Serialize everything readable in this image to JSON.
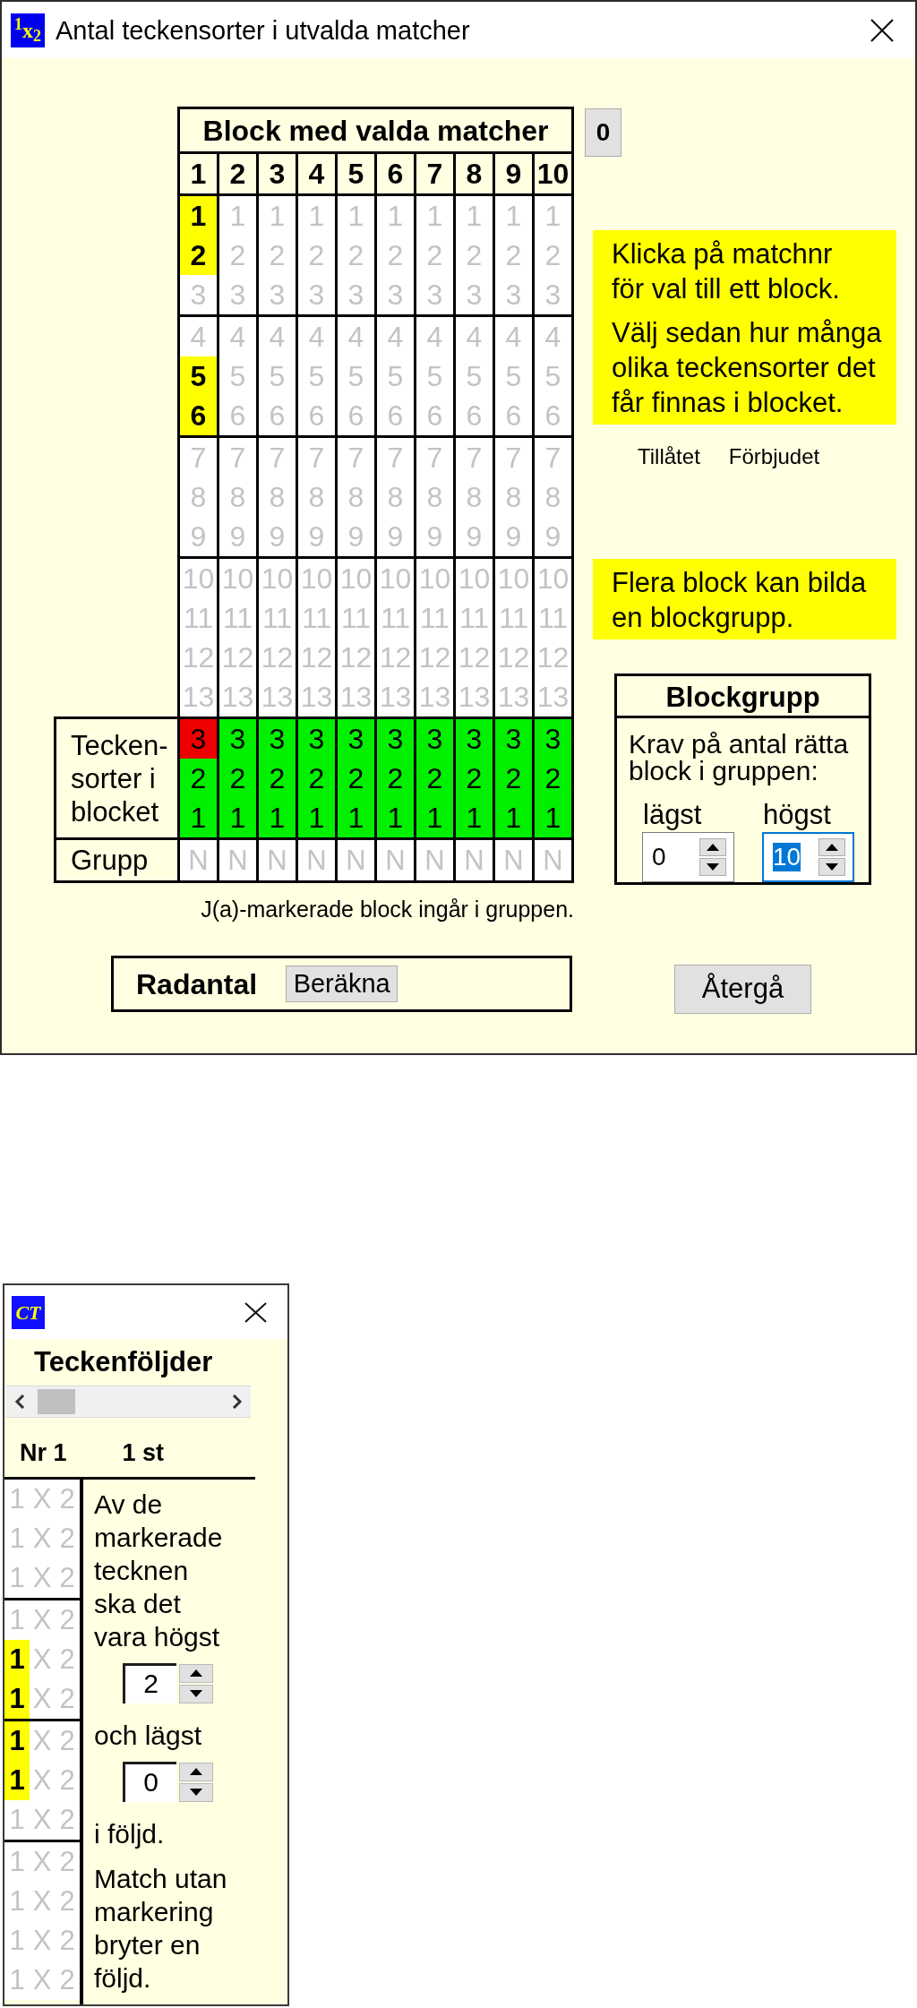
{
  "window": {
    "app_icon": "$^{1}$x$_{2}$",
    "title": "Antal teckensorter i utvalda matcher"
  },
  "grid": {
    "title": "Block med valda matcher",
    "row_labels": [
      "Tecken-\nsorter i\nblocket",
      "Grupp"
    ],
    "columns": [
      {
        "label": "1",
        "match_groups": [
          [
            {
              "text": "1",
              "marked": true
            },
            {
              "text": "2",
              "marked": true
            },
            {
              "text": "3",
              "marked": false
            }
          ],
          [
            {
              "text": "4",
              "marked": false
            },
            {
              "text": "5",
              "marked": true
            },
            {
              "text": "6",
              "marked": true
            }
          ],
          [
            {
              "text": "7",
              "marked": false
            },
            {
              "text": "8",
              "marked": false
            },
            {
              "text": "9",
              "marked": false
            }
          ],
          [
            {
              "text": "10",
              "marked": false
            },
            {
              "text": "11",
              "marked": false
            },
            {
              "text": "12",
              "marked": false
            },
            {
              "text": "13",
              "marked": false
            }
          ]
        ],
        "sign_sorts": [
          {
            "text": "3",
            "allowed": false
          },
          {
            "text": "2",
            "allowed": true
          },
          {
            "text": "1",
            "allowed": true
          }
        ],
        "group": "N"
      },
      {
        "label": "2",
        "match_groups": [
          [
            {
              "text": "1",
              "marked": false
            },
            {
              "text": "2",
              "marked": false
            },
            {
              "text": "3",
              "marked": false
            }
          ],
          [
            {
              "text": "4",
              "marked": false
            },
            {
              "text": "5",
              "marked": false
            },
            {
              "text": "6",
              "marked": false
            }
          ],
          [
            {
              "text": "7",
              "marked": false
            },
            {
              "text": "8",
              "marked": false
            },
            {
              "text": "9",
              "marked": false
            }
          ],
          [
            {
              "text": "10",
              "marked": false
            },
            {
              "text": "11",
              "marked": false
            },
            {
              "text": "12",
              "marked": false
            },
            {
              "text": "13",
              "marked": false
            }
          ]
        ],
        "sign_sorts": [
          {
            "text": "3",
            "allowed": true
          },
          {
            "text": "2",
            "allowed": true
          },
          {
            "text": "1",
            "allowed": true
          }
        ],
        "group": "N"
      },
      {
        "label": "3",
        "match_groups": [
          [
            {
              "text": "1",
              "marked": false
            },
            {
              "text": "2",
              "marked": false
            },
            {
              "text": "3",
              "marked": false
            }
          ],
          [
            {
              "text": "4",
              "marked": false
            },
            {
              "text": "5",
              "marked": false
            },
            {
              "text": "6",
              "marked": false
            }
          ],
          [
            {
              "text": "7",
              "marked": false
            },
            {
              "text": "8",
              "marked": false
            },
            {
              "text": "9",
              "marked": false
            }
          ],
          [
            {
              "text": "10",
              "marked": false
            },
            {
              "text": "11",
              "marked": false
            },
            {
              "text": "12",
              "marked": false
            },
            {
              "text": "13",
              "marked": false
            }
          ]
        ],
        "sign_sorts": [
          {
            "text": "3",
            "allowed": true
          },
          {
            "text": "2",
            "allowed": true
          },
          {
            "text": "1",
            "allowed": true
          }
        ],
        "group": "N"
      },
      {
        "label": "4",
        "match_groups": [
          [
            {
              "text": "1",
              "marked": false
            },
            {
              "text": "2",
              "marked": false
            },
            {
              "text": "3",
              "marked": false
            }
          ],
          [
            {
              "text": "4",
              "marked": false
            },
            {
              "text": "5",
              "marked": false
            },
            {
              "text": "6",
              "marked": false
            }
          ],
          [
            {
              "text": "7",
              "marked": false
            },
            {
              "text": "8",
              "marked": false
            },
            {
              "text": "9",
              "marked": false
            }
          ],
          [
            {
              "text": "10",
              "marked": false
            },
            {
              "text": "11",
              "marked": false
            },
            {
              "text": "12",
              "marked": false
            },
            {
              "text": "13",
              "marked": false
            }
          ]
        ],
        "sign_sorts": [
          {
            "text": "3",
            "allowed": true
          },
          {
            "text": "2",
            "allowed": true
          },
          {
            "text": "1",
            "allowed": true
          }
        ],
        "group": "N"
      },
      {
        "label": "5",
        "match_groups": [
          [
            {
              "text": "1",
              "marked": false
            },
            {
              "text": "2",
              "marked": false
            },
            {
              "text": "3",
              "marked": false
            }
          ],
          [
            {
              "text": "4",
              "marked": false
            },
            {
              "text": "5",
              "marked": false
            },
            {
              "text": "6",
              "marked": false
            }
          ],
          [
            {
              "text": "7",
              "marked": false
            },
            {
              "text": "8",
              "marked": false
            },
            {
              "text": "9",
              "marked": false
            }
          ],
          [
            {
              "text": "10",
              "marked": false
            },
            {
              "text": "11",
              "marked": false
            },
            {
              "text": "12",
              "marked": false
            },
            {
              "text": "13",
              "marked": false
            }
          ]
        ],
        "sign_sorts": [
          {
            "text": "3",
            "allowed": true
          },
          {
            "text": "2",
            "allowed": true
          },
          {
            "text": "1",
            "allowed": true
          }
        ],
        "group": "N"
      },
      {
        "label": "6",
        "match_groups": [
          [
            {
              "text": "1",
              "marked": false
            },
            {
              "text": "2",
              "marked": false
            },
            {
              "text": "3",
              "marked": false
            }
          ],
          [
            {
              "text": "4",
              "marked": false
            },
            {
              "text": "5",
              "marked": false
            },
            {
              "text": "6",
              "marked": false
            }
          ],
          [
            {
              "text": "7",
              "marked": false
            },
            {
              "text": "8",
              "marked": false
            },
            {
              "text": "9",
              "marked": false
            }
          ],
          [
            {
              "text": "10",
              "marked": false
            },
            {
              "text": "11",
              "marked": false
            },
            {
              "text": "12",
              "marked": false
            },
            {
              "text": "13",
              "marked": false
            }
          ]
        ],
        "sign_sorts": [
          {
            "text": "3",
            "allowed": true
          },
          {
            "text": "2",
            "allowed": true
          },
          {
            "text": "1",
            "allowed": true
          }
        ],
        "group": "N"
      },
      {
        "label": "7",
        "match_groups": [
          [
            {
              "text": "1",
              "marked": false
            },
            {
              "text": "2",
              "marked": false
            },
            {
              "text": "3",
              "marked": false
            }
          ],
          [
            {
              "text": "4",
              "marked": false
            },
            {
              "text": "5",
              "marked": false
            },
            {
              "text": "6",
              "marked": false
            }
          ],
          [
            {
              "text": "7",
              "marked": false
            },
            {
              "text": "8",
              "marked": false
            },
            {
              "text": "9",
              "marked": false
            }
          ],
          [
            {
              "text": "10",
              "marked": false
            },
            {
              "text": "11",
              "marked": false
            },
            {
              "text": "12",
              "marked": false
            },
            {
              "text": "13",
              "marked": false
            }
          ]
        ],
        "sign_sorts": [
          {
            "text": "3",
            "allowed": true
          },
          {
            "text": "2",
            "allowed": true
          },
          {
            "text": "1",
            "allowed": true
          }
        ],
        "group": "N"
      },
      {
        "label": "8",
        "match_groups": [
          [
            {
              "text": "1",
              "marked": false
            },
            {
              "text": "2",
              "marked": false
            },
            {
              "text": "3",
              "marked": false
            }
          ],
          [
            {
              "text": "4",
              "marked": false
            },
            {
              "text": "5",
              "marked": false
            },
            {
              "text": "6",
              "marked": false
            }
          ],
          [
            {
              "text": "7",
              "marked": false
            },
            {
              "text": "8",
              "marked": false
            },
            {
              "text": "9",
              "marked": false
            }
          ],
          [
            {
              "text": "10",
              "marked": false
            },
            {
              "text": "11",
              "marked": false
            },
            {
              "text": "12",
              "marked": false
            },
            {
              "text": "13",
              "marked": false
            }
          ]
        ],
        "sign_sorts": [
          {
            "text": "3",
            "allowed": true
          },
          {
            "text": "2",
            "allowed": true
          },
          {
            "text": "1",
            "allowed": true
          }
        ],
        "group": "N"
      },
      {
        "label": "9",
        "match_groups": [
          [
            {
              "text": "1",
              "marked": false
            },
            {
              "text": "2",
              "marked": false
            },
            {
              "text": "3",
              "marked": false
            }
          ],
          [
            {
              "text": "4",
              "marked": false
            },
            {
              "text": "5",
              "marked": false
            },
            {
              "text": "6",
              "marked": false
            }
          ],
          [
            {
              "text": "7",
              "marked": false
            },
            {
              "text": "8",
              "marked": false
            },
            {
              "text": "9",
              "marked": false
            }
          ],
          [
            {
              "text": "10",
              "marked": false
            },
            {
              "text": "11",
              "marked": false
            },
            {
              "text": "12",
              "marked": false
            },
            {
              "text": "13",
              "marked": false
            }
          ]
        ],
        "sign_sorts": [
          {
            "text": "3",
            "allowed": true
          },
          {
            "text": "2",
            "allowed": true
          },
          {
            "text": "1",
            "allowed": true
          }
        ],
        "group": "N"
      },
      {
        "label": "10",
        "match_groups": [
          [
            {
              "text": "1",
              "marked": false
            },
            {
              "text": "2",
              "marked": false
            },
            {
              "text": "3",
              "marked": false
            }
          ],
          [
            {
              "text": "4",
              "marked": false
            },
            {
              "text": "5",
              "marked": false
            },
            {
              "text": "6",
              "marked": false
            }
          ],
          [
            {
              "text": "7",
              "marked": false
            },
            {
              "text": "8",
              "marked": false
            },
            {
              "text": "9",
              "marked": false
            }
          ],
          [
            {
              "text": "10",
              "marked": false
            },
            {
              "text": "11",
              "marked": false
            },
            {
              "text": "12",
              "marked": false
            },
            {
              "text": "13",
              "marked": false
            }
          ]
        ],
        "sign_sorts": [
          {
            "text": "3",
            "allowed": true
          },
          {
            "text": "2",
            "allowed": true
          },
          {
            "text": "1",
            "allowed": true
          }
        ],
        "group": "N"
      }
    ]
  },
  "counter_button": "0",
  "footnote": "J(a)-markerade block ingår i gruppen.",
  "row_count": {
    "label": "Radantal",
    "button": "Beräkna"
  },
  "instructions": [
    "Klicka på matchnr\nför val till ett block.",
    "Välj sedan hur många\nolika teckensorter det\nfår finnas i blocket."
  ],
  "legend": [
    "Tillåtet",
    "Förbjudet"
  ],
  "group_hint": [
    "Flera block kan bilda\nen blockgrupp."
  ],
  "block_group": {
    "title": "Blockgrupp",
    "requirement": "Krav på antal rätta\nblock i gruppen:",
    "fields": [
      {
        "label": "lägst",
        "value": "0",
        "focused": false
      },
      {
        "label": "högst",
        "value": "10",
        "focused": true
      }
    ]
  },
  "back_button": "Återgå",
  "sequence_window": {
    "app_icon": "CT",
    "title": "Teckenföljder",
    "number": "Nr 1",
    "count": "1 st",
    "match_groups": [
      [
        {
          "signs": [
            {
              "text": "1",
              "marked": false
            },
            {
              "text": "X",
              "marked": false
            },
            {
              "text": "2",
              "marked": false
            }
          ]
        },
        {
          "signs": [
            {
              "text": "1",
              "marked": false
            },
            {
              "text": "X",
              "marked": false
            },
            {
              "text": "2",
              "marked": false
            }
          ]
        },
        {
          "signs": [
            {
              "text": "1",
              "marked": false
            },
            {
              "text": "X",
              "marked": false
            },
            {
              "text": "2",
              "marked": false
            }
          ]
        }
      ],
      [
        {
          "signs": [
            {
              "text": "1",
              "marked": false
            },
            {
              "text": "X",
              "marked": false
            },
            {
              "text": "2",
              "marked": false
            }
          ]
        },
        {
          "signs": [
            {
              "text": "1",
              "marked": true
            },
            {
              "text": "X",
              "marked": false
            },
            {
              "text": "2",
              "marked": false
            }
          ]
        },
        {
          "signs": [
            {
              "text": "1",
              "marked": true
            },
            {
              "text": "X",
              "marked": false
            },
            {
              "text": "2",
              "marked": false
            }
          ]
        }
      ],
      [
        {
          "signs": [
            {
              "text": "1",
              "marked": true
            },
            {
              "text": "X",
              "marked": false
            },
            {
              "text": "2",
              "marked": false
            }
          ]
        },
        {
          "signs": [
            {
              "text": "1",
              "marked": true
            },
            {
              "text": "X",
              "marked": false
            },
            {
              "text": "2",
              "marked": false
            }
          ]
        },
        {
          "signs": [
            {
              "text": "1",
              "marked": false
            },
            {
              "text": "X",
              "marked": false
            },
            {
              "text": "2",
              "marked": false
            }
          ]
        }
      ],
      [
        {
          "signs": [
            {
              "text": "1",
              "marked": false
            },
            {
              "text": "X",
              "marked": false
            },
            {
              "text": "2",
              "marked": false
            }
          ]
        },
        {
          "signs": [
            {
              "text": "1",
              "marked": false
            },
            {
              "text": "X",
              "marked": false
            },
            {
              "text": "2",
              "marked": false
            }
          ]
        },
        {
          "signs": [
            {
              "text": "1",
              "marked": false
            },
            {
              "text": "X",
              "marked": false
            },
            {
              "text": "2",
              "marked": false
            }
          ]
        },
        {
          "signs": [
            {
              "text": "1",
              "marked": false
            },
            {
              "text": "X",
              "marked": false
            },
            {
              "text": "2",
              "marked": false
            }
          ]
        }
      ]
    ],
    "rule": [
      {
        "kind": "text",
        "text": "Av de\nmarkerade\ntecknen\nska det\nvara högst"
      },
      {
        "kind": "spinner",
        "value": "2"
      },
      {
        "kind": "text",
        "text": "och lägst"
      },
      {
        "kind": "spinner",
        "value": "0"
      },
      {
        "kind": "text",
        "text": "i följd."
      },
      {
        "kind": "text",
        "text": "Match utan\nmarkering\nbryter en\nföljd."
      }
    ]
  }
}
